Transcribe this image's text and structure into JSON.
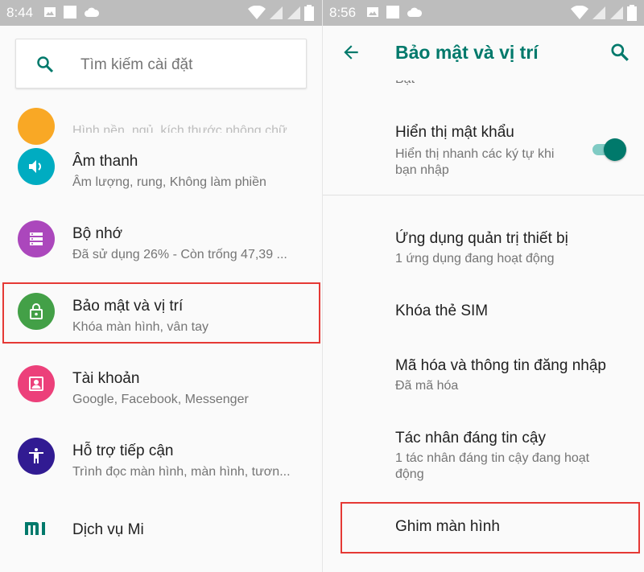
{
  "left": {
    "status": {
      "time": "8:44"
    },
    "search": {
      "placeholder": "Tìm kiếm cài đặt"
    },
    "clipped_item": {
      "sub": "Hình nền, ngủ, kích thước phông chữ"
    },
    "items": [
      {
        "title": "Âm thanh",
        "sub": "Âm lượng, rung, Không làm phiền",
        "icon": "volume-icon",
        "color": "#00acc1"
      },
      {
        "title": "Bộ nhớ",
        "sub": "Đã sử dụng 26% - Còn trống 47,39 ...",
        "icon": "storage-icon",
        "color": "#ab47bc"
      },
      {
        "title": "Bảo mật và vị trí",
        "sub": "Khóa màn hình, vân tay",
        "icon": "lock-icon",
        "color": "#43a047"
      },
      {
        "title": "Tài khoản",
        "sub": "Google, Facebook, Messenger",
        "icon": "account-icon",
        "color": "#ec407a"
      },
      {
        "title": "Hỗ trợ tiếp cận",
        "sub": "Trình đọc màn hình, màn hình, tươn...",
        "icon": "accessibility-icon",
        "color": "#311b92"
      },
      {
        "title": "Dịch vụ Mi",
        "sub": "",
        "icon": "mi-logo-icon",
        "color": "#00796b"
      }
    ]
  },
  "right": {
    "status": {
      "time": "8:56"
    },
    "title": "Bảo mật và vị trí",
    "peek": "Bật",
    "show_password": {
      "title": "Hiển thị mật khẩu",
      "sub": "Hiển thị nhanh các ký tự khi bạn nhập",
      "enabled": true
    },
    "items": [
      {
        "title": "Ứng dụng quản trị thiết bị",
        "sub": "1 ứng dụng đang hoạt động"
      },
      {
        "title": "Khóa thẻ SIM",
        "sub": ""
      },
      {
        "title": "Mã hóa và thông tin đăng nhập",
        "sub": "Đã mã hóa"
      },
      {
        "title": "Tác nhân đáng tin cậy",
        "sub": "1 tác nhân đáng tin cậy đang hoạt động"
      },
      {
        "title": "Ghim màn hình",
        "sub": ""
      }
    ]
  },
  "colors": {
    "accent": "#00796b",
    "highlight": "#e53935"
  }
}
